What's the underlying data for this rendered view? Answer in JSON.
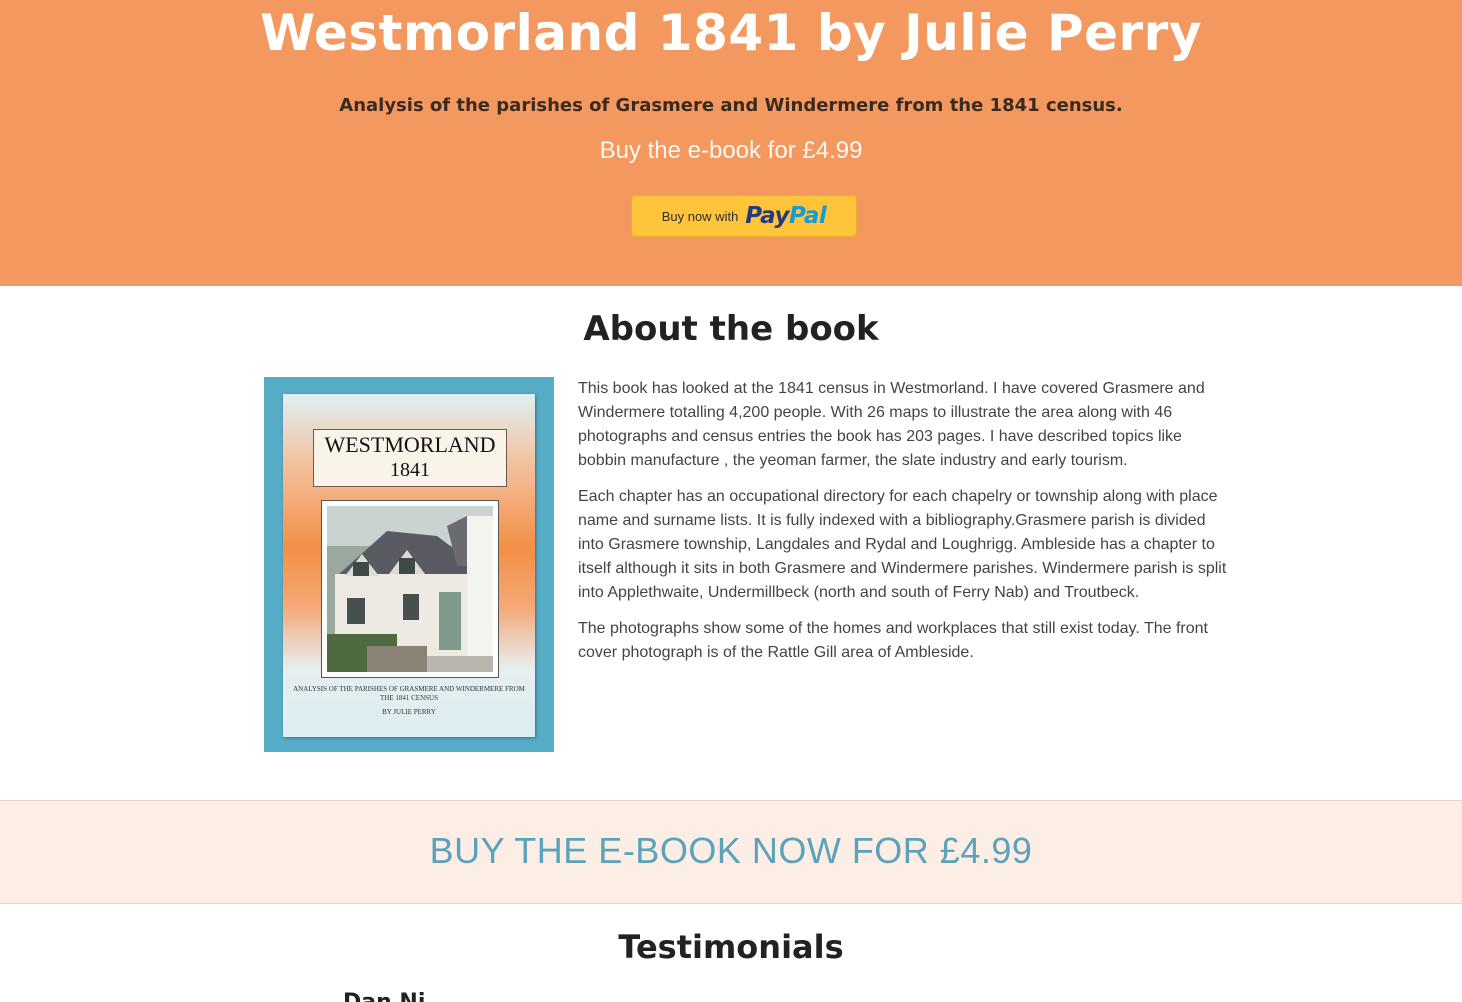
{
  "header": {
    "title": "Westmorland 1841 by Julie Perry",
    "subtitle": "Analysis of the parishes of Grasmere and Windermere from the 1841 census.",
    "price_line": "Buy the e-book for £4.99",
    "paypal": {
      "prefix": "Buy now with",
      "brand_pay": "Pay",
      "brand_pal": "Pal"
    }
  },
  "about": {
    "title": "About the book",
    "cover": {
      "title_line1": "WESTMORLAND",
      "title_line2": "1841",
      "caption": "ANALYSIS OF THE PARISHES OF GRASMERE AND WINDERMERE FROM THE 1841 CENSUS",
      "author": "BY JULIE PERRY"
    },
    "paragraphs": [
      "This book has looked at the 1841 census in Westmorland. I have covered Grasmere and Windermere totalling 4,200 people. With 26 maps to illustrate the area along with 46 photographs and census entries the book has 203 pages. I have described topics like bobbin manufacture , the yeoman farmer, the slate industry and early tourism.",
      "Each chapter has an occupational directory for each chapelry or township along with place name and surname lists. It is fully indexed with a bibliography.Grasmere parish is divided into Grasmere township, Langdales and Rydal and Loughrigg. Ambleside has a chapter to itself  although it sits in both Grasmere and Windermere parishes. Windermere parish is split into Applethwaite, Undermillbeck (north and south of Ferry Nab) and Troutbeck.",
      "The photographs show some of the homes and workplaces that still exist today. The front cover photograph is of the Rattle Gill area of Ambleside."
    ]
  },
  "cta": {
    "label": "BUY THE E-BOOK NOW FOR £4.99"
  },
  "testimonials": {
    "title": "Testimonials",
    "first_name_partial": "Dan  Ni"
  },
  "colors": {
    "header_bg": "#f3995f",
    "cta_bg": "#fdeee5",
    "cta_text": "#5aa3bb",
    "paypal_yellow": "#ffc439",
    "cover_frame": "#56acc6"
  }
}
